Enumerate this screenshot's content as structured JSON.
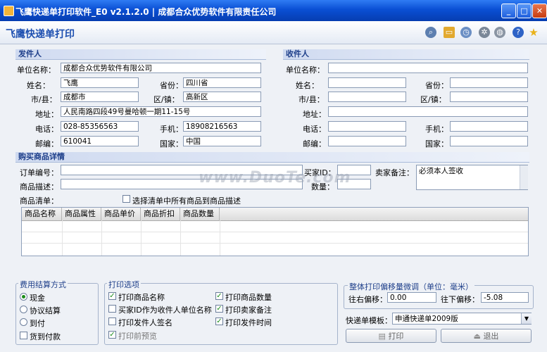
{
  "window": {
    "title": "飞鹰快递单打印软件_E0 v2.1.2.0 | 成都合众优势软件有限责任公司"
  },
  "header": {
    "title": "飞鹰快递单打印"
  },
  "toolbar_icons": [
    "search-icon",
    "folder-icon",
    "clock-icon",
    "gear-icon",
    "network-icon",
    "help-icon",
    "star-icon"
  ],
  "sender": {
    "section": "发件人",
    "labels": {
      "company": "单位名称：",
      "name": "姓名：",
      "province": "省份：",
      "city": "市/县：",
      "district": "区/镇：",
      "address": "地址：",
      "phone": "电话：",
      "mobile": "手机：",
      "zip": "邮编：",
      "country": "国家："
    },
    "values": {
      "company": "成都合众优势软件有限公司",
      "name": "飞鹰",
      "province": "四川省",
      "city": "成都市",
      "district": "高新区",
      "address": "人民南路四段49号曼哈顿一期11-15号",
      "phone": "028-85356563",
      "mobile": "18908216563",
      "zip": "610041",
      "country": "中国"
    }
  },
  "receiver": {
    "section": "收件人",
    "labels": {
      "company": "单位名称：",
      "name": "姓名：",
      "province": "省份：",
      "city": "市/县：",
      "district": "区/镇：",
      "address": "地址：",
      "phone": "电话：",
      "mobile": "手机：",
      "zip": "邮编：",
      "country": "国家："
    }
  },
  "goods": {
    "section": "购买商品详情",
    "order_label": "订单编号：",
    "buyer_id_label": "买家ID：",
    "seller_note_label": "卖家备注：",
    "seller_note_value": "必须本人签收",
    "desc_label": "商品描述：",
    "qty_label": "数量：",
    "list_label": "商品清单：",
    "select_all_label": "选择清单中所有商品到商品描述",
    "columns": [
      "商品名称",
      "商品属性",
      "商品单价",
      "商品折扣",
      "商品数量"
    ]
  },
  "payment": {
    "title": "费用结算方式",
    "options": [
      "现金",
      "协议结算",
      "到付"
    ],
    "selected": "现金",
    "cod_label": "货到付款"
  },
  "print_options": {
    "title": "打印选项",
    "items": [
      {
        "label": "打印商品名称",
        "checked": true
      },
      {
        "label": "打印商品数量",
        "checked": true
      },
      {
        "label": "买家ID作为收件人单位名称",
        "checked": false
      },
      {
        "label": "打印卖家备注",
        "checked": true
      },
      {
        "label": "打印发件人签名",
        "checked": false
      },
      {
        "label": "打印发件时间",
        "checked": true
      },
      {
        "label": "打印前预览",
        "checked": true
      }
    ]
  },
  "offset": {
    "title": "整体打印偏移量微调（单位：毫米）",
    "lr_label": "往右偏移：",
    "lr_value": "0.00",
    "down_label": "往下偏移：",
    "down_value": "-5.08"
  },
  "template": {
    "label": "快递单模板：",
    "value": "申通快递单2009版"
  },
  "buttons": {
    "print": "打印",
    "exit": "退出"
  },
  "watermark": "www.DuoTe.com"
}
